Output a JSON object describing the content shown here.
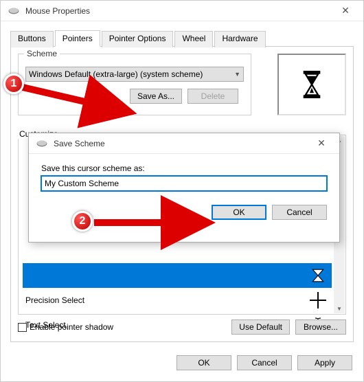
{
  "window": {
    "title": "Mouse Properties",
    "tabs": [
      "Buttons",
      "Pointers",
      "Pointer Options",
      "Wheel",
      "Hardware"
    ],
    "active_tab": "Pointers"
  },
  "scheme": {
    "group_label": "Scheme",
    "selected": "Windows Default (extra-large) (system scheme)",
    "save_as": "Save As...",
    "delete": "Delete"
  },
  "customize": {
    "label": "Customize",
    "items": [
      {
        "label": "",
        "icon": "busy-selected"
      },
      {
        "label": "Precision Select",
        "icon": "precision"
      },
      {
        "label": "Text Select",
        "icon": "ibeam"
      }
    ]
  },
  "options": {
    "enable_shadow": "Enable pointer shadow",
    "use_default": "Use Default",
    "browse": "Browse..."
  },
  "buttons": {
    "ok": "OK",
    "cancel": "Cancel",
    "apply": "Apply"
  },
  "modal": {
    "title": "Save Scheme",
    "prompt": "Save this cursor scheme as:",
    "value": "My Custom Scheme",
    "ok": "OK",
    "cancel": "Cancel"
  },
  "callouts": {
    "1": "1",
    "2": "2"
  }
}
